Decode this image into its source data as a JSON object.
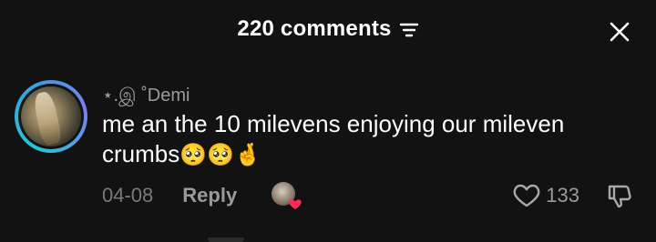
{
  "header": {
    "title": "220 comments",
    "sort_icon": "sort-filter-icon",
    "close_icon": "close-icon"
  },
  "comment": {
    "username": "⋆.இ ˚Demi",
    "text": "me an the 10 milevens enjoying our mileven crumbs",
    "emojis": "🥺🥺🤞",
    "date": "04-08",
    "reply_label": "Reply",
    "creator_liked": true,
    "likes": "133",
    "icons": {
      "like": "heart-outline-icon",
      "dislike": "thumbs-down-icon",
      "creator_heart": "heart-badge-icon"
    }
  },
  "colors": {
    "background": "#121212",
    "primary_text": "#ffffff",
    "secondary_text": "#9a9a9a",
    "avatar_ring": "#22c7d8",
    "heart_badge": "#fe2c55"
  }
}
